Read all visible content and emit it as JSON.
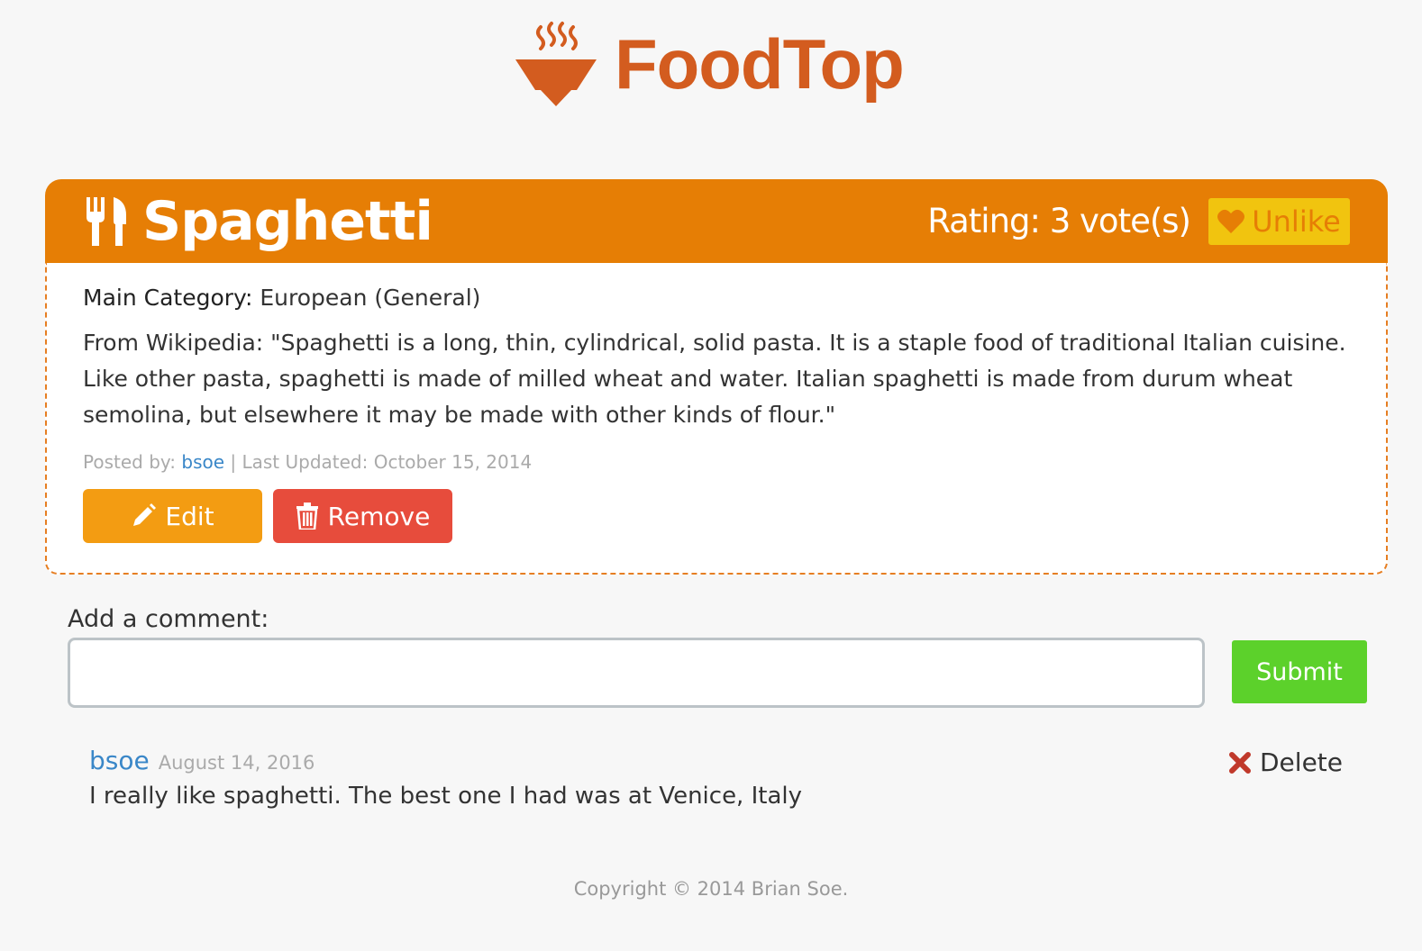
{
  "brand": {
    "name": "FoodTop",
    "color": "#d35c1f"
  },
  "food": {
    "title": "Spaghetti",
    "icon": "fork-knife-icon",
    "rating_text": "Rating: 3 vote(s)",
    "unlike_label": "Unlike",
    "category_label": "Main Category:",
    "category_value": " European (General)",
    "description": "From Wikipedia: \"Spaghetti is a long, thin, cylindrical, solid pasta. It is a staple food of traditional Italian cuisine. Like other pasta, spaghetti is made of milled wheat and water. Italian spaghetti is made from durum wheat semolina, but elsewhere it may be made with other kinds of flour.\"",
    "posted_by_label": "Posted by: ",
    "posted_by_user": "bsoe",
    "last_updated": " | Last Updated: October 15, 2014",
    "edit_label": "Edit",
    "remove_label": "Remove"
  },
  "comment_form": {
    "label": "Add a comment:",
    "value": "",
    "submit_label": "Submit"
  },
  "comments": [
    {
      "author": "bsoe",
      "date": "August 14, 2016",
      "text": "I really like spaghetti. The best one I had was at Venice, Italy",
      "delete_label": "Delete"
    }
  ],
  "footer": {
    "text": "Copyright © 2014 Brian Soe."
  },
  "colors": {
    "header": "#e67e05",
    "unlike_bg": "#f1c40f",
    "edit": "#f39c12",
    "remove": "#e74c3c",
    "submit": "#5cd12b",
    "link": "#3a87c8",
    "delete_x": "#c0392b"
  }
}
